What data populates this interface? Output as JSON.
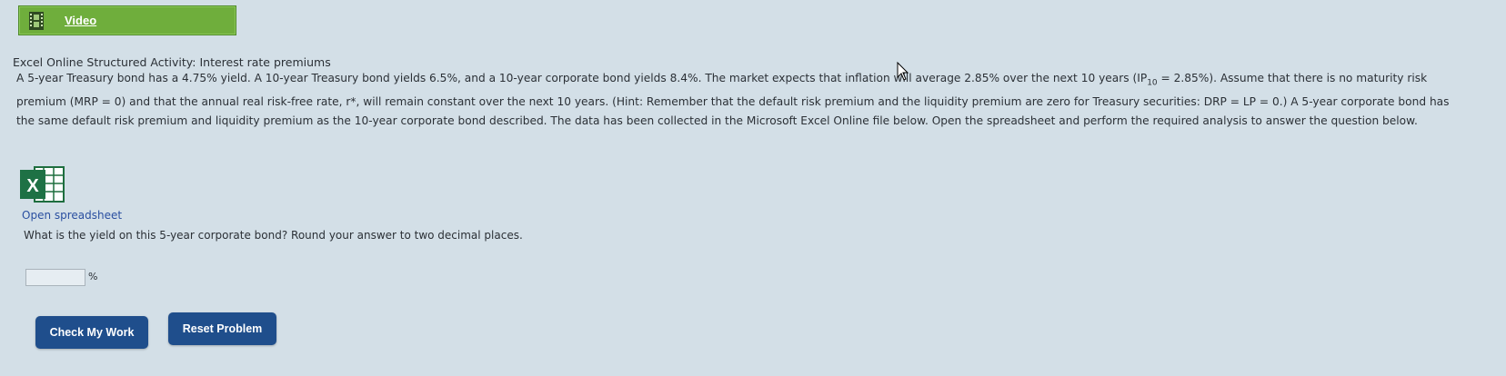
{
  "video": {
    "label": "Video",
    "icon": "film-icon",
    "color": "#6fae3c"
  },
  "activity": {
    "title": "Excel Online Structured Activity: Interest rate premiums"
  },
  "problem": {
    "line1": "A 5-year Treasury bond has a 4.75% yield. A 10-year Treasury bond yields 6.5%, and a 10-year corporate bond yields 8.4%. The market expects that inflation will average 2.85% over the next 10 years (IP",
    "line1_sub": "10",
    "line1_end": " = 2.85%). Assume that there is no maturity risk",
    "line2": "premium (MRP = 0) and that the annual real risk-free rate, r*, will remain constant over the next 10 years. (Hint: Remember that the default risk premium and the liquidity premium are zero for Treasury securities: DRP = LP = 0.) A 5-year corporate bond has",
    "line3": "the same default risk premium and liquidity premium as the 10-year corporate bond described. The data has been collected in the Microsoft Excel Online file below. Open the spreadsheet and perform the required analysis to answer the question below."
  },
  "spreadsheet": {
    "icon": "excel-icon",
    "icon_letter": "X",
    "link_label": "Open spreadsheet",
    "link_color": "#2a4fa0"
  },
  "question": {
    "text": "What is the yield on this 5-year corporate bond? Round your answer to two decimal places.",
    "input_value": "",
    "unit": "%"
  },
  "buttons": {
    "check_label": "Check My Work",
    "reset_label": "Reset Problem",
    "color": "#1f4e8c"
  }
}
